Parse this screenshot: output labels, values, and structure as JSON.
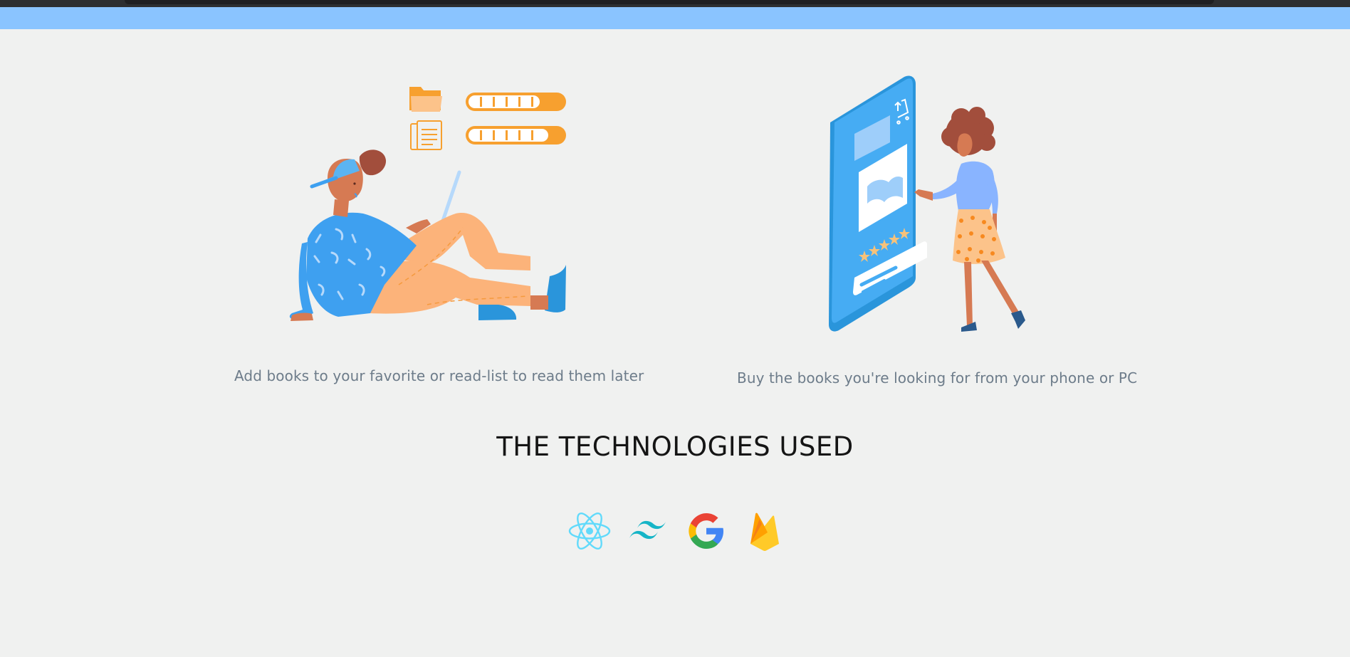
{
  "features": [
    {
      "illustration": "person-reading-laptop-illustration",
      "caption": "Add books to your favorite or read-list to read them later"
    },
    {
      "illustration": "woman-phone-shop-illustration",
      "caption": "Buy the books you're looking for from your phone or PC"
    }
  ],
  "technologies": {
    "title": "THE TECHNOLOGIES USED",
    "items": [
      {
        "name": "react-icon"
      },
      {
        "name": "tailwind-icon"
      },
      {
        "name": "google-icon"
      },
      {
        "name": "firebase-icon"
      }
    ]
  },
  "colors": {
    "top_bar": "#8ac4ff",
    "background": "#f0f1f0",
    "accent_orange": "#f7a02f",
    "accent_blue": "#3ea0f0"
  }
}
